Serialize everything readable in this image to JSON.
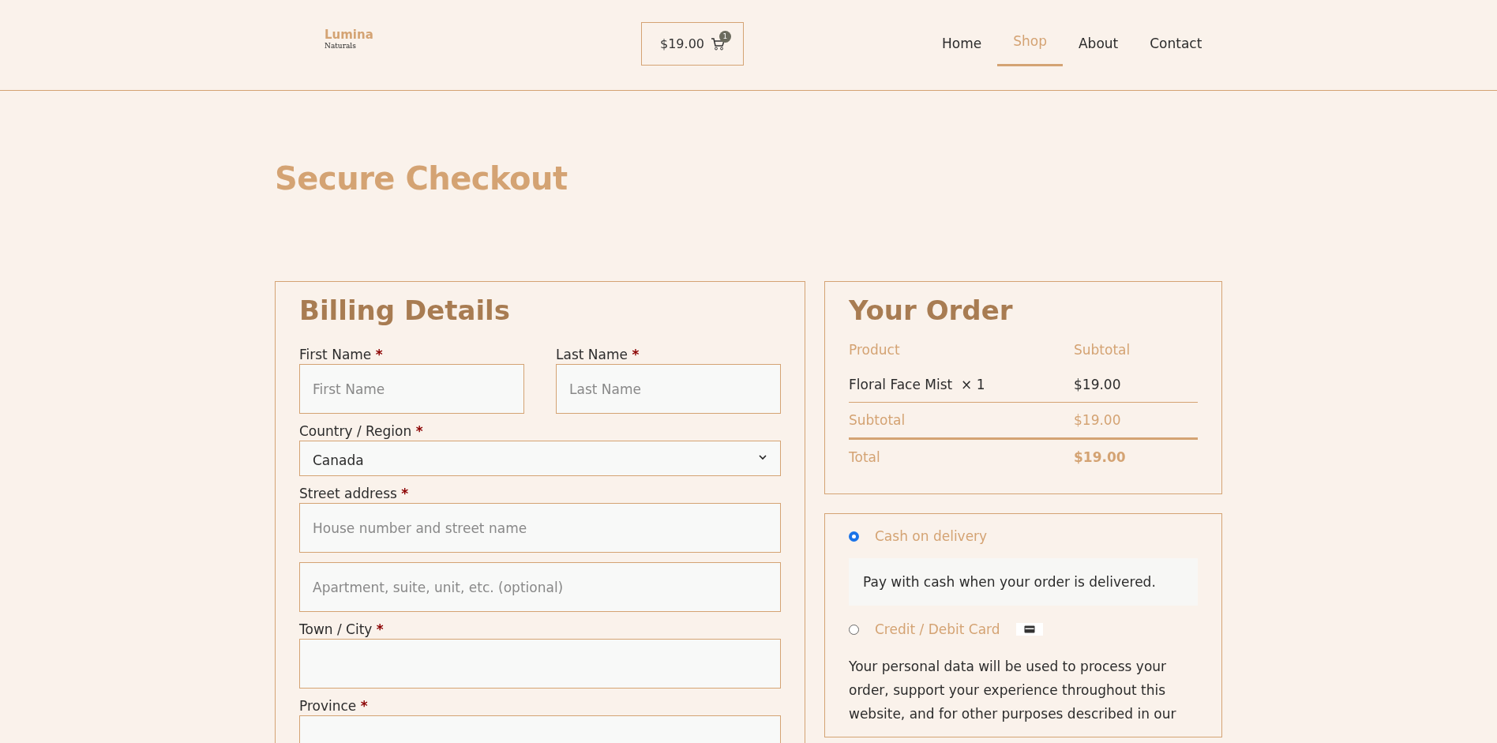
{
  "header": {
    "logo": {
      "name": "Lumina",
      "tagline": "Naturals"
    },
    "cart": {
      "total": "$19.00",
      "count": "1"
    },
    "nav": [
      {
        "label": "Home",
        "selected": false
      },
      {
        "label": "Shop",
        "selected": true
      },
      {
        "label": "About",
        "selected": false
      },
      {
        "label": "Contact",
        "selected": false
      }
    ]
  },
  "page_title": "Secure Checkout",
  "billing": {
    "title": "Billing Details",
    "required_mark": "*",
    "rows": [
      {
        "fields": [
          {
            "kind": "text",
            "label": "First Name",
            "required": true,
            "placeholder": "First Name"
          },
          {
            "kind": "text",
            "label": "Last Name",
            "required": true,
            "placeholder": "Last Name"
          }
        ]
      },
      {
        "fields": [
          {
            "kind": "select",
            "label": "Country / Region",
            "required": true,
            "value": "Canada"
          }
        ]
      },
      {
        "fields": [
          {
            "kind": "text",
            "label": "Street address",
            "required": true,
            "placeholder": "House number and street name"
          }
        ]
      },
      {
        "fields": [
          {
            "kind": "text",
            "placeholder": "Apartment, suite, unit, etc. (optional)"
          }
        ]
      },
      {
        "fields": [
          {
            "kind": "text",
            "label": "Town / City",
            "required": true
          }
        ]
      },
      {
        "fields": [
          {
            "kind": "text",
            "label": "Province",
            "required": true
          }
        ]
      }
    ]
  },
  "order": {
    "title": "Your Order",
    "columns": [
      "Product",
      "Subtotal"
    ],
    "items": [
      {
        "product": "Floral Face Mist",
        "quantity": "× 1",
        "subtotal": "$19.00"
      }
    ],
    "subtotal": {
      "label": "Subtotal",
      "value": "$19.00"
    },
    "total": {
      "label": "Total",
      "value": "$19.00"
    }
  },
  "payment": {
    "methods": [
      {
        "kind": "plain",
        "label": "Cash on delivery",
        "selected": true,
        "description": "Pay with cash when your order is delivered."
      },
      {
        "kind": "card",
        "label": "Credit / Debit Card",
        "selected": false
      }
    ],
    "privacy": "Your personal data will be used to process your order, support your experience throughout this website, and for other purposes described in our"
  }
}
